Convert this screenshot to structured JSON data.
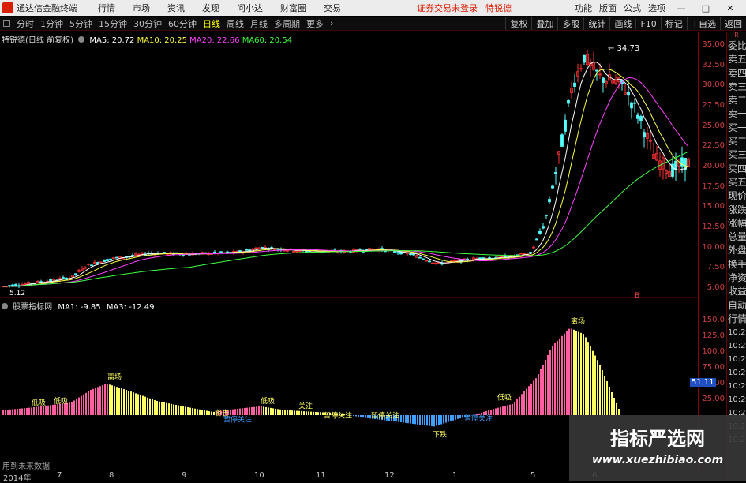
{
  "window": {
    "app_title": "通达信金融终端",
    "menus": [
      "行情",
      "市场",
      "资讯",
      "发现",
      "问小达",
      "财富圈",
      "交易"
    ],
    "notice": "证券交易未登录",
    "stock_name_top": "特锐德",
    "right_menus": [
      "功能",
      "版面",
      "公式",
      "选项"
    ]
  },
  "toolbar": {
    "periods": [
      "分时",
      "1分钟",
      "5分钟",
      "15分钟",
      "30分钟",
      "60分钟",
      "日线",
      "周线",
      "月线",
      "多周期",
      "更多"
    ],
    "active_period": "日线",
    "right_buttons": [
      "复权",
      "叠加",
      "多股",
      "统计",
      "画线",
      "F10",
      "标记",
      "+自选",
      "返回"
    ]
  },
  "main_chart": {
    "header": "特锐德(日线 前复权)",
    "ma": [
      {
        "label": "MA5: 20.72",
        "color": "#ffffff"
      },
      {
        "label": "MA10: 20.25",
        "color": "#ffff40"
      },
      {
        "label": "MA20: 22.66",
        "color": "#ff40ff"
      },
      {
        "label": "MA60: 20.54",
        "color": "#40ff40"
      }
    ],
    "y_ticks": [
      "35.00",
      "32.50",
      "30.00",
      "27.50",
      "25.00",
      "22.50",
      "20.00",
      "17.50",
      "15.00",
      "12.50",
      "10.00",
      "7.50",
      "5.00"
    ],
    "high_label": "34.73",
    "low_label": "5.12",
    "marker_b": "B"
  },
  "sub_chart": {
    "name": "股票指标网",
    "ma1": "MA1: -9.85",
    "ma3": "MA3: -12.49",
    "y_ticks": [
      "150.0",
      "125.0",
      "100.0",
      "75.00",
      "50.00",
      "25.00"
    ],
    "current_value": "51.11",
    "annotations": {
      "top": "离场",
      "rebound": "离场",
      "dip": "低吸",
      "fall": "下跌",
      "attention": "关注",
      "pause": "暂停关注",
      "warning": "警告"
    }
  },
  "x_axis": [
    "2014年",
    "7",
    "8",
    "9",
    "10",
    "11",
    "12",
    "1",
    "5",
    "6"
  ],
  "bottom_note": "用到未来数据",
  "side_panel": {
    "items": [
      "委比",
      "卖五",
      "卖四",
      "卖三",
      "卖二",
      "卖一",
      "买一",
      "买二",
      "买三",
      "买四",
      "买五",
      "现价",
      "涨跌",
      "涨幅",
      "总量",
      "外盘",
      "换手",
      "净资",
      "收益"
    ],
    "extra": [
      "自动",
      "行情"
    ],
    "times": [
      "10:26",
      "10:26",
      "10:26",
      "10:26",
      "10:26",
      "10:26",
      "10:26",
      "10:26",
      "10:26"
    ],
    "top_tag": "R"
  },
  "watermark": {
    "cn": "指标严选网",
    "url": "www.xuezhibiao.com"
  },
  "colors": {
    "up": "#ff3232",
    "down": "#54ffff",
    "pink": "#ff5fa0",
    "yellow": "#ffff66",
    "blue": "#40a0ff",
    "axis": "#d04040"
  }
}
